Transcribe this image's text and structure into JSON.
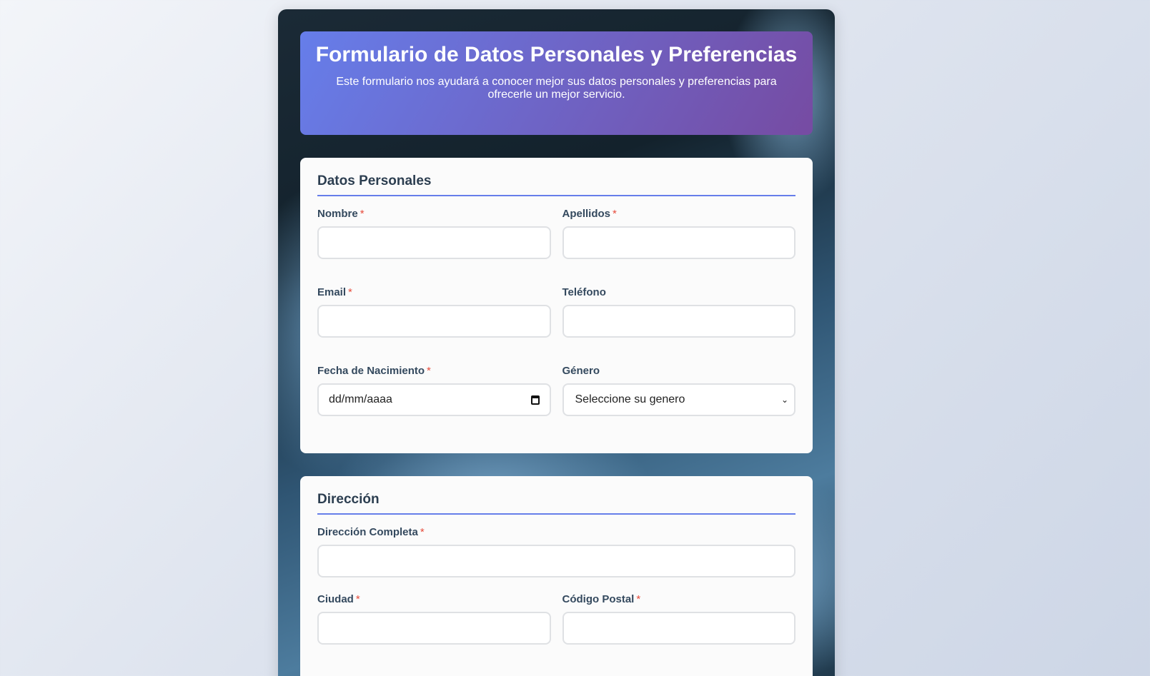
{
  "header": {
    "title": "Formulario de Datos Personales y Preferencias",
    "subtitle": "Este formulario nos ayudará a conocer mejor sus datos personales y preferencias para ofrecerle un mejor servicio."
  },
  "personal": {
    "title": "Datos Personales",
    "nombre": "Nombre",
    "apellidos": "Apellidos",
    "email": "Email",
    "telefono": "Teléfono",
    "fecha": "Fecha de Nacimiento",
    "fecha_placeholder": "dd/mm/aaaa",
    "genero": "Género",
    "genero_value": "Seleccione su genero"
  },
  "address": {
    "title": "Dirección",
    "direccion": "Dirección Completa",
    "ciudad": "Ciudad",
    "postal": "Código Postal"
  },
  "required_mark": "*"
}
